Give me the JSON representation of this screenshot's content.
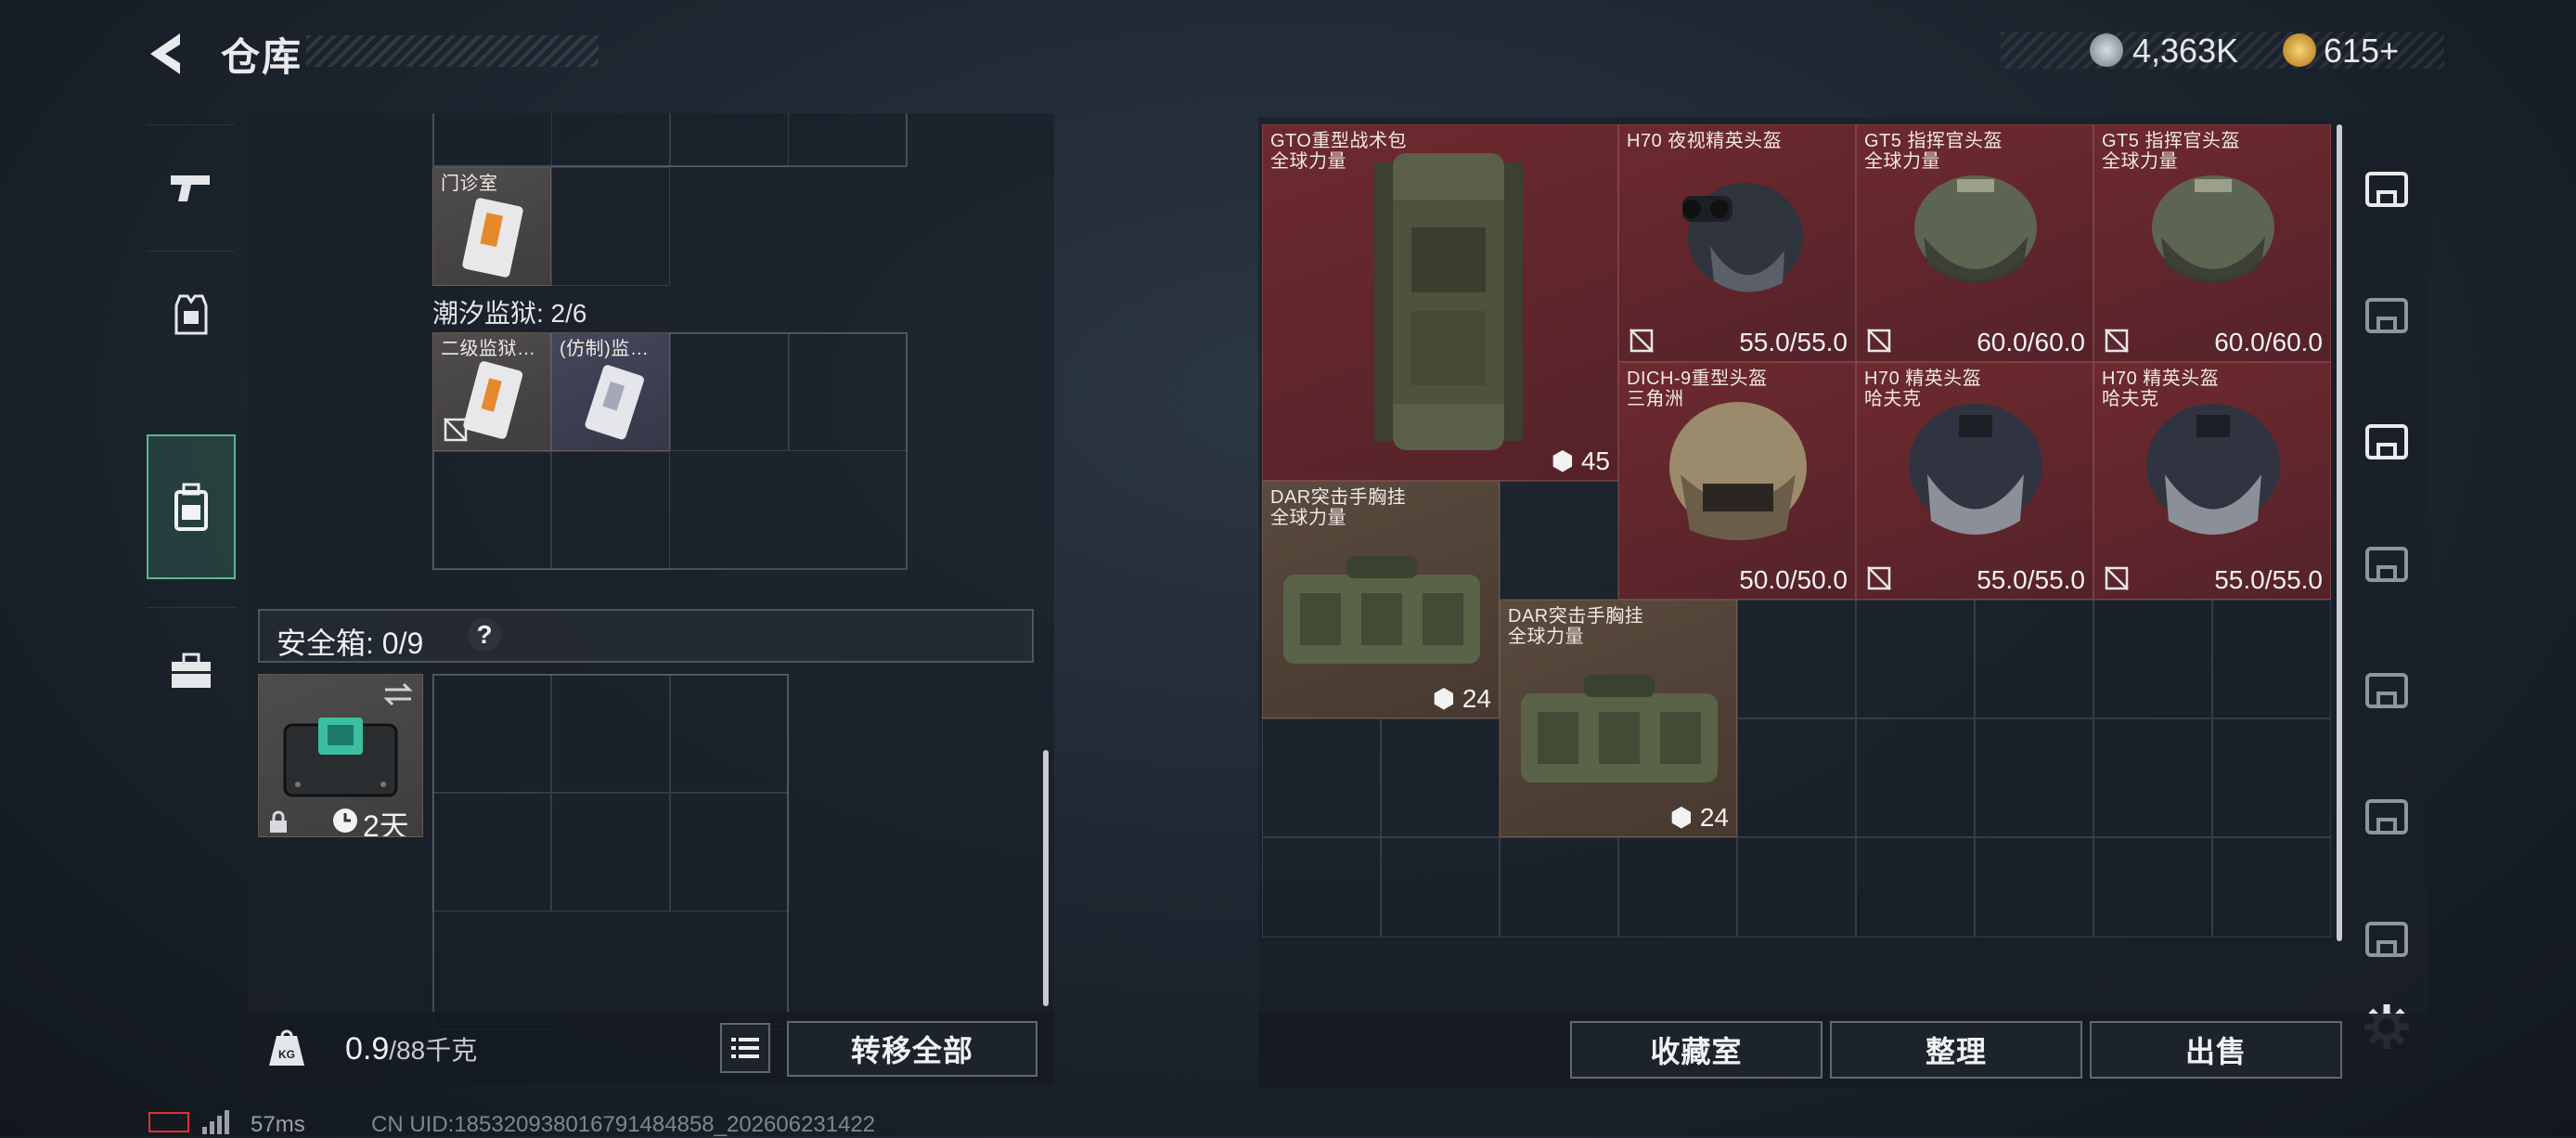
{
  "header": {
    "title": "仓库",
    "currency": [
      {
        "icon": "silver-coin-icon",
        "value": "4,363K"
      },
      {
        "icon": "gold-coin-icon",
        "value": "615+"
      }
    ]
  },
  "left_nav": {
    "items": [
      {
        "icon": "pistol-icon",
        "active": false
      },
      {
        "icon": "vest-icon",
        "active": false
      },
      {
        "icon": "backpack-icon",
        "active": true
      },
      {
        "icon": "toolbox-icon",
        "active": false
      }
    ]
  },
  "backpack": {
    "items": [
      {
        "name": "门诊室",
        "bg": "grey"
      },
      {
        "name": "二级监狱…",
        "bg": "grey"
      },
      {
        "name": "(仿制)监…",
        "bg": "slate"
      }
    ],
    "section_label": "潮汐监狱: 2/6",
    "safebox_label": "安全箱: 0/9",
    "safebox_help": "?",
    "safebox_item": {
      "timer": "2天"
    }
  },
  "footer_left": {
    "weight_current": "0.9",
    "weight_max": "/88千克",
    "transfer_all": "转移全部"
  },
  "stash": {
    "items": [
      {
        "name": "GTO重型战术包",
        "sub": "全球力量",
        "value": "45",
        "bg": "red",
        "kind": "backpack"
      },
      {
        "name": "H70 夜视精英头盔",
        "sub": "",
        "value": "55.0/55.0",
        "bg": "red",
        "kind": "nv-helmet"
      },
      {
        "name": "GT5 指挥官头盔",
        "sub": "全球力量",
        "value": "60.0/60.0",
        "bg": "red",
        "kind": "visor-helmet"
      },
      {
        "name": "GT5 指挥官头盔",
        "sub": "全球力量",
        "value": "60.0/60.0",
        "bg": "red",
        "kind": "visor-helmet"
      },
      {
        "name": "DICH-9重型头盔",
        "sub": "三角洲",
        "value": "50.0/50.0",
        "bg": "red",
        "kind": "tan-helmet"
      },
      {
        "name": "H70 精英头盔",
        "sub": "哈夫克",
        "value": "55.0/55.0",
        "bg": "red",
        "kind": "mask-helmet"
      },
      {
        "name": "H70 精英头盔",
        "sub": "哈夫克",
        "value": "55.0/55.0",
        "bg": "red",
        "kind": "mask-helmet"
      },
      {
        "name": "DAR突击手胸挂",
        "sub": "全球力量",
        "value": "24",
        "bg": "brown",
        "kind": "rig"
      },
      {
        "name": "DAR突击手胸挂",
        "sub": "全球力量",
        "value": "24",
        "bg": "brown",
        "kind": "rig"
      }
    ]
  },
  "footer_right": {
    "collection": "收藏室",
    "sort": "整理",
    "sell": "出售"
  },
  "right_nav": {
    "icons": [
      "base-icon",
      "tier-g-icon",
      "tier-iv-icon",
      "tier-iv-box-icon",
      "tier-v-icon",
      "tier-v-icon",
      "tier-v-icon"
    ]
  },
  "status": {
    "ping": "57ms",
    "uid": "CN UID:18532093801679148485​8_202606231422"
  }
}
